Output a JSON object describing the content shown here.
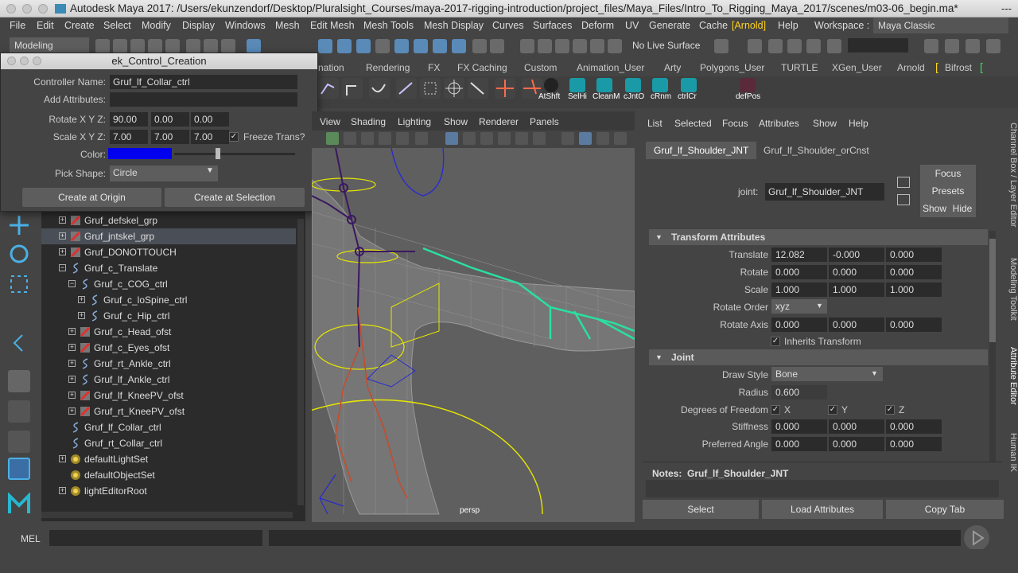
{
  "window": {
    "title": "Autodesk Maya 2017: /Users/ekunzendorf/Desktop/Pluralsight_Courses/maya-2017-rigging-introduction/project_files/Maya_Files/Intro_To_Rigging_Maya_2017/scenes/m03-06_begin.ma*",
    "title_suffix": "---"
  },
  "menubar": {
    "items": [
      "File",
      "Edit",
      "Create",
      "Select",
      "Modify",
      "Display",
      "Windows",
      "Mesh",
      "Edit Mesh",
      "Mesh Tools",
      "Mesh Display",
      "Curves",
      "Surfaces",
      "Deform",
      "UV",
      "Generate",
      "Cache",
      "[Arnold]",
      "Help"
    ],
    "workspace_label": "Workspace :",
    "workspace_value": "Maya Classic"
  },
  "statusline": {
    "mode": "Modeling",
    "live_surface": "No Live Surface"
  },
  "shelf": {
    "tabs": [
      "nation",
      "Rendering",
      "FX",
      "FX Caching",
      "Custom",
      "Animation_User",
      "Arty",
      "Polygons_User",
      "TURTLE",
      "XGen_User",
      "Arnold",
      "Bifrost"
    ],
    "buttons": [
      "AtShft",
      "SelHi",
      "CleanM",
      "cJntO",
      "cRnm",
      "ctrlCr",
      "defPos"
    ]
  },
  "control_window": {
    "title": "ek_Control_Creation",
    "controller_name_label": "Controller Name:",
    "controller_name_value": "Gruf_lf_Collar_ctrl",
    "add_attributes_label": "Add Attributes:",
    "add_attributes_value": "",
    "rotate_label": "Rotate X Y Z:",
    "rotate": [
      "90.00",
      "0.00",
      "0.00"
    ],
    "scale_label": "Scale X Y Z:",
    "scale": [
      "7.00",
      "7.00",
      "7.00"
    ],
    "freeze_label": "Freeze Trans?",
    "freeze_checked": "✓",
    "color_label": "Color:",
    "color_value": "#0000ee",
    "shape_label": "Pick Shape:",
    "shape_value": "Circle",
    "create_origin": "Create at Origin",
    "create_selection": "Create at Selection"
  },
  "outliner": {
    "rows": [
      {
        "label": "Gruf_defskel_grp",
        "exp": "+",
        "icon": "joint-group-icon",
        "indent": 0
      },
      {
        "label": "Gruf_jntskel_grp",
        "exp": "+",
        "icon": "joint-group-icon",
        "indent": 0,
        "selected": true
      },
      {
        "label": "Gruf_DONOTTOUCH",
        "exp": "+",
        "icon": "joint-group-icon",
        "indent": 0
      },
      {
        "label": "Gruf_c_Translate",
        "exp": "−",
        "icon": "curve-icon",
        "indent": 0
      },
      {
        "label": "Gruf_c_COG_ctrl",
        "exp": "−",
        "icon": "curve-icon",
        "indent": 1
      },
      {
        "label": "Gruf_c_loSpine_ctrl",
        "exp": "+",
        "icon": "curve-icon",
        "indent": 2
      },
      {
        "label": "Gruf_c_Hip_ctrl",
        "exp": "+",
        "icon": "curve-icon",
        "indent": 2
      },
      {
        "label": "Gruf_c_Head_ofst",
        "exp": "+",
        "icon": "joint-group-icon",
        "indent": 1
      },
      {
        "label": "Gruf_c_Eyes_ofst",
        "exp": "+",
        "icon": "joint-group-icon",
        "indent": 1
      },
      {
        "label": "Gruf_rt_Ankle_ctrl",
        "exp": "+",
        "icon": "curve-icon",
        "indent": 1
      },
      {
        "label": "Gruf_lf_Ankle_ctrl",
        "exp": "+",
        "icon": "curve-icon",
        "indent": 1
      },
      {
        "label": "Gruf_lf_KneePV_ofst",
        "exp": "+",
        "icon": "joint-group-icon",
        "indent": 1
      },
      {
        "label": "Gruf_rt_KneePV_ofst",
        "exp": "+",
        "icon": "joint-group-icon",
        "indent": 1
      },
      {
        "label": "Gruf_lf_Collar_ctrl",
        "exp": "",
        "icon": "curve-icon",
        "indent": 0
      },
      {
        "label": "Gruf_rt_Collar_ctrl",
        "exp": "",
        "icon": "curve-icon",
        "indent": 0
      },
      {
        "label": "defaultLightSet",
        "exp": "+",
        "icon": "set-icon",
        "indent": 0
      },
      {
        "label": "defaultObjectSet",
        "exp": "",
        "icon": "set-icon",
        "indent": 0
      },
      {
        "label": "lightEditorRoot",
        "exp": "+",
        "icon": "set-icon",
        "indent": 0
      }
    ]
  },
  "viewport": {
    "menu": [
      "View",
      "Shading",
      "Lighting",
      "Show",
      "Renderer",
      "Panels"
    ],
    "camera": "persp"
  },
  "attribute_editor": {
    "menu": [
      "List",
      "Selected",
      "Focus",
      "Attributes",
      "Show",
      "Help"
    ],
    "tabs": [
      "Gruf_lf_Shoulder_JNT",
      "Gruf_lf_Shoulder_orCnst"
    ],
    "node_label": "joint:",
    "node_value": "Gruf_lf_Shoulder_JNT",
    "focus": "Focus",
    "presets": "Presets",
    "show": "Show",
    "hide": "Hide",
    "transform_section": "Transform Attributes",
    "translate_label": "Translate",
    "translate": [
      "12.082",
      "-0.000",
      "0.000"
    ],
    "rotate_label": "Rotate",
    "rotate": [
      "0.000",
      "0.000",
      "0.000"
    ],
    "scale_label": "Scale",
    "scale": [
      "1.000",
      "1.000",
      "1.000"
    ],
    "rotate_order_label": "Rotate Order",
    "rotate_order": "xyz",
    "rotate_axis_label": "Rotate Axis",
    "rotate_axis": [
      "0.000",
      "0.000",
      "0.000"
    ],
    "inherits_label": "Inherits Transform",
    "joint_section": "Joint",
    "draw_style_label": "Draw Style",
    "draw_style": "Bone",
    "radius_label": "Radius",
    "radius": "0.600",
    "dof_label": "Degrees of Freedom",
    "dof": [
      "X",
      "Y",
      "Z"
    ],
    "stiffness_label": "Stiffness",
    "stiffness": [
      "0.000",
      "0.000",
      "0.000"
    ],
    "preferred_label": "Preferred Angle",
    "preferred": [
      "0.000",
      "0.000",
      "0.000"
    ],
    "notes_label": "Notes:",
    "notes_value": "Gruf_lf_Shoulder_JNT",
    "select": "Select",
    "load": "Load Attributes",
    "copy": "Copy Tab"
  },
  "side_tabs": [
    "Channel Box / Layer Editor",
    "Modeling Toolkit",
    "Attribute Editor",
    "Human IK"
  ],
  "cmdline": {
    "label": "MEL"
  }
}
